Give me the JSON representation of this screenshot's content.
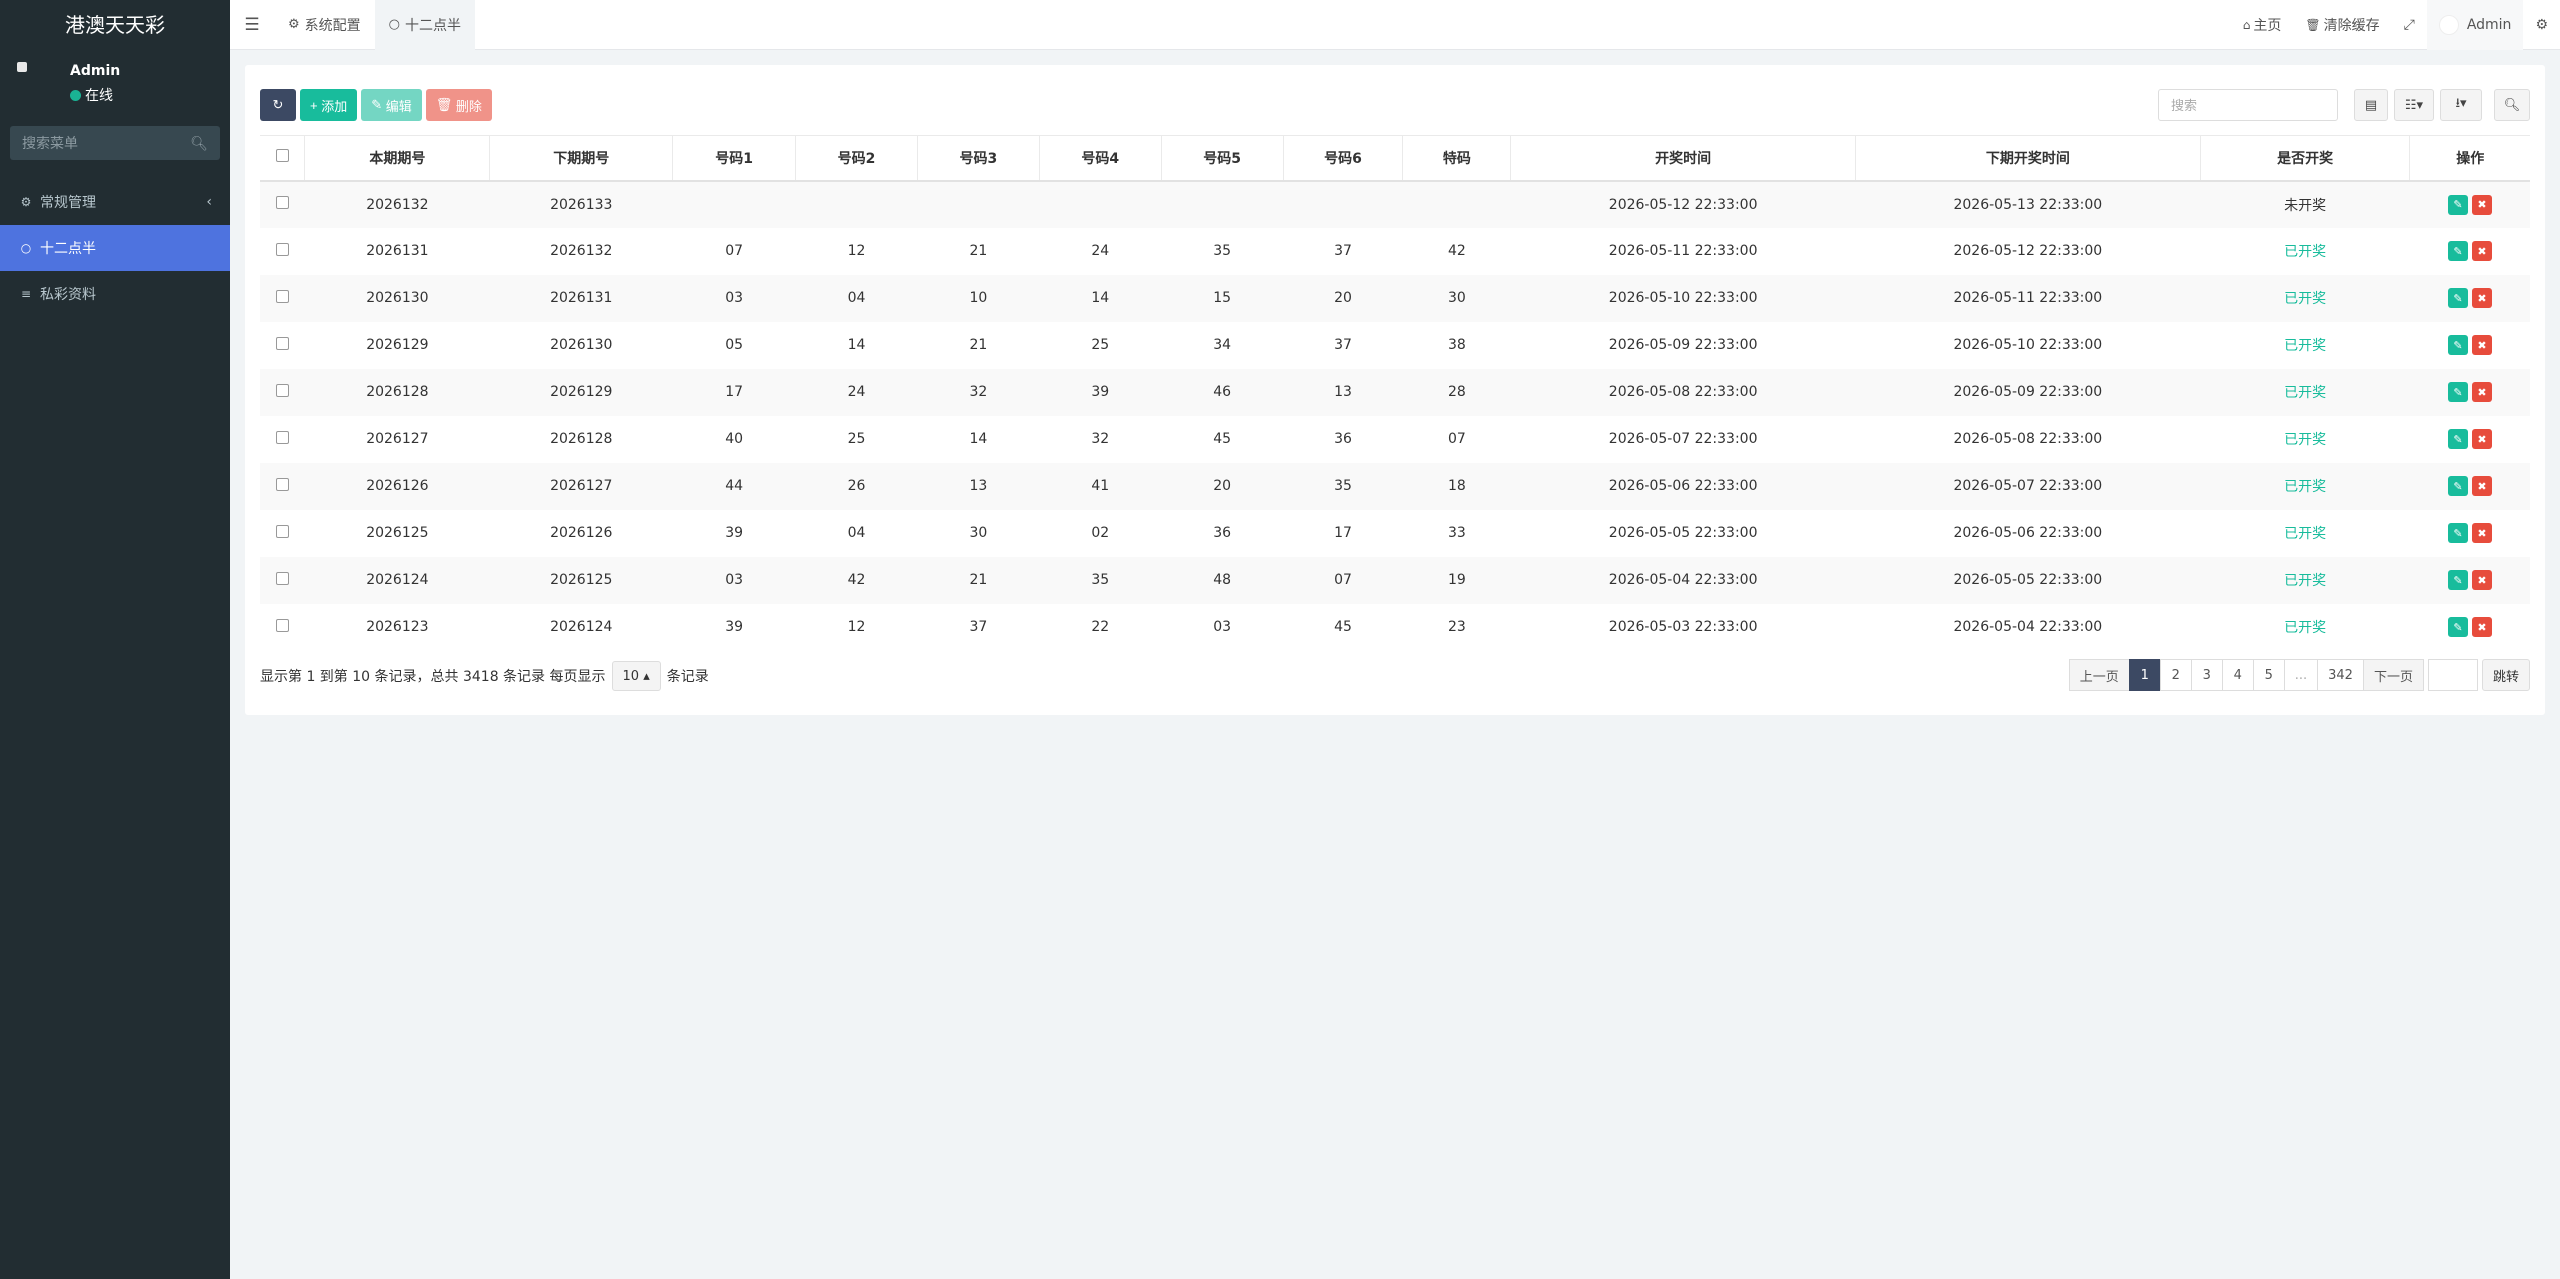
{
  "brand": "港澳天天彩",
  "user": {
    "name": "Admin",
    "status": "在线"
  },
  "sidebar": {
    "search_placeholder": "搜索菜单",
    "items": [
      {
        "label": "常规管理",
        "icon": "cogs-icon"
      },
      {
        "label": "十二点半",
        "icon": "circle-icon",
        "active": true
      },
      {
        "label": "私彩资料",
        "icon": "database-icon"
      }
    ]
  },
  "header": {
    "tabs": [
      {
        "label": "系统配置",
        "icon": "gear-icon"
      },
      {
        "label": "十二点半",
        "icon": "circle-icon",
        "active": true
      }
    ],
    "home_label": "主页",
    "clear_cache_label": "清除缓存",
    "user_label": "Admin"
  },
  "toolbar": {
    "add_label": "添加",
    "edit_label": "编辑",
    "delete_label": "删除",
    "search_placeholder": "搜索"
  },
  "table": {
    "columns": [
      "本期期号",
      "下期期号",
      "号码1",
      "号码2",
      "号码3",
      "号码4",
      "号码5",
      "号码6",
      "特码",
      "开奖时间",
      "下期开奖时间",
      "是否开奖",
      "操作"
    ],
    "rows": [
      [
        "2026132",
        "2026133",
        "",
        "",
        "",
        "",
        "",
        "",
        "",
        "2026-05-12 22:33:00",
        "2026-05-13 22:33:00",
        "未开奖"
      ],
      [
        "2026131",
        "2026132",
        "07",
        "12",
        "21",
        "24",
        "35",
        "37",
        "42",
        "2026-05-11 22:33:00",
        "2026-05-12 22:33:00",
        "已开奖"
      ],
      [
        "2026130",
        "2026131",
        "03",
        "04",
        "10",
        "14",
        "15",
        "20",
        "30",
        "2026-05-10 22:33:00",
        "2026-05-11 22:33:00",
        "已开奖"
      ],
      [
        "2026129",
        "2026130",
        "05",
        "14",
        "21",
        "25",
        "34",
        "37",
        "38",
        "2026-05-09 22:33:00",
        "2026-05-10 22:33:00",
        "已开奖"
      ],
      [
        "2026128",
        "2026129",
        "17",
        "24",
        "32",
        "39",
        "46",
        "13",
        "28",
        "2026-05-08 22:33:00",
        "2026-05-09 22:33:00",
        "已开奖"
      ],
      [
        "2026127",
        "2026128",
        "40",
        "25",
        "14",
        "32",
        "45",
        "36",
        "07",
        "2026-05-07 22:33:00",
        "2026-05-08 22:33:00",
        "已开奖"
      ],
      [
        "2026126",
        "2026127",
        "44",
        "26",
        "13",
        "41",
        "20",
        "35",
        "18",
        "2026-05-06 22:33:00",
        "2026-05-07 22:33:00",
        "已开奖"
      ],
      [
        "2026125",
        "2026126",
        "39",
        "04",
        "30",
        "02",
        "36",
        "17",
        "33",
        "2026-05-05 22:33:00",
        "2026-05-06 22:33:00",
        "已开奖"
      ],
      [
        "2026124",
        "2026125",
        "03",
        "42",
        "21",
        "35",
        "48",
        "07",
        "19",
        "2026-05-04 22:33:00",
        "2026-05-05 22:33:00",
        "已开奖"
      ],
      [
        "2026123",
        "2026124",
        "39",
        "12",
        "37",
        "22",
        "03",
        "45",
        "23",
        "2026-05-03 22:33:00",
        "2026-05-04 22:33:00",
        "已开奖"
      ]
    ]
  },
  "footer": {
    "info_prefix": "显示第 1 到第 10 条记录，总共 3418 条记录 每页显示",
    "page_size": "10",
    "info_suffix": "条记录",
    "prev_label": "上一页",
    "next_label": "下一页",
    "pages": [
      "1",
      "2",
      "3",
      "4",
      "5",
      "...",
      "342"
    ],
    "current_page": "1",
    "jump_label": "跳转"
  },
  "colors": {
    "sidebar_bg": "#222d32",
    "active": "#4e73df",
    "success": "#18bc9c",
    "danger": "#e74c3c",
    "dark_btn": "#3c4963"
  }
}
